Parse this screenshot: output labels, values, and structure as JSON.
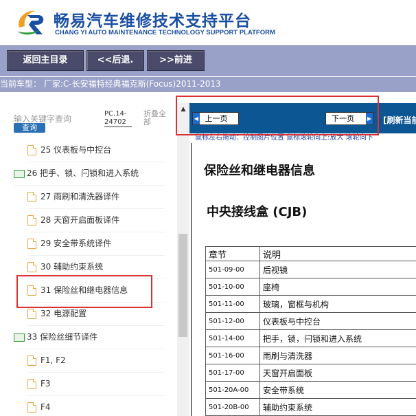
{
  "header": {
    "brand_cn": "畅易汽车维修技术支持平台",
    "brand_en": "CHANG YI AUTO MAINTENANCE TECHNOLOGY SUPPORT PLATFORM"
  },
  "nav": {
    "home": "返回主目录",
    "back": "<<后退.",
    "forward": ">>前进"
  },
  "car": {
    "text": "当前车型：  厂家:C-长安福特经典福克斯(Focus)2011-2013"
  },
  "sidebar": {
    "search_placeholder": "输入关键字查询",
    "search_button": "查询",
    "pc_code": "PC.14-24702",
    "collapse_all": "折叠全部",
    "items": [
      {
        "label": "25 仪表板与中控台",
        "type": "doc"
      },
      {
        "label": "26 把手、锁、闩锁和进入系统",
        "type": "folder"
      },
      {
        "label": "27 雨刷和清洗器译件",
        "type": "doc"
      },
      {
        "label": "28 天窗开启面板译件",
        "type": "doc"
      },
      {
        "label": "29 安全带系统译件",
        "type": "doc"
      },
      {
        "label": "30 辅助约束系统",
        "type": "doc"
      },
      {
        "label": "31 保险丝和继电器信息",
        "type": "doc"
      },
      {
        "label": "32 电源配置",
        "type": "doc"
      },
      {
        "label": "33 保险丝细节译件",
        "type": "folder"
      },
      {
        "label": "F1, F2",
        "type": "doc"
      },
      {
        "label": "F3",
        "type": "doc"
      },
      {
        "label": "F4",
        "type": "doc"
      }
    ]
  },
  "viewer": {
    "prev_page": "上一页",
    "next_page": "下一页",
    "refresh": "[刷新当前",
    "hint": "鼠标左右拖动：控制图片位置  鼠标滚轮向上:放大   滚轮向下"
  },
  "document": {
    "title": "保险丝和继电器信息",
    "subtitle": "中央接线盒 (CJB)",
    "table_headers": [
      "章节",
      "说明"
    ],
    "rows": [
      [
        "501-09-00",
        "后视镜"
      ],
      [
        "501-10-00",
        "座椅"
      ],
      [
        "501-11-00",
        "玻璃，窗框与机构"
      ],
      [
        "501-12-00",
        "仪表板与中控台"
      ],
      [
        "501-14-00",
        "把手，锁，闩锁和进入系统"
      ],
      [
        "501-16-00",
        "雨刷与清洗器"
      ],
      [
        "501-17-00",
        "天窗开启面板"
      ],
      [
        "501-20A-00",
        "安全带系统"
      ],
      [
        "501-20B-00",
        "辅助约束系统"
      ]
    ]
  },
  "colors": {
    "brand_blue": "#1b4fa3",
    "nav_bg": "#9aa1c8",
    "viewer_bar": "#0c5694",
    "highlight": "#d83232"
  }
}
